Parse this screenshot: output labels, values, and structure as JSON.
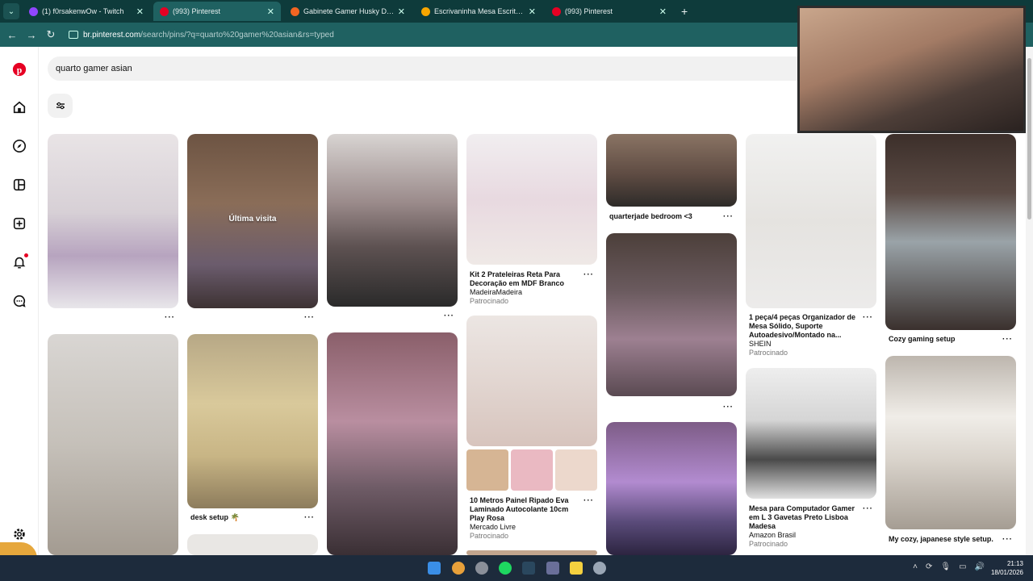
{
  "browser": {
    "tabs": [
      {
        "title": "(1) f0rsakenwOw - Twitch",
        "active": false,
        "color": "#9146ff"
      },
      {
        "title": "(993) Pinterest",
        "active": true,
        "color": "#e60023"
      },
      {
        "title": "Gabinete Gamer Husky Dome I",
        "active": false,
        "color": "#f26522"
      },
      {
        "title": "Escrivaninha Mesa Escritório An",
        "active": false,
        "color": "#f7a600"
      },
      {
        "title": "(993) Pinterest",
        "active": false,
        "color": "#e60023"
      }
    ],
    "url_host": "br.pinterest.com",
    "url_path": "/search/pins/?q=quarto%20gamer%20asian&rs=typed"
  },
  "search": {
    "query": "quarto gamer asian"
  },
  "pins": {
    "p1": {
      "dots": "···"
    },
    "p2": {
      "overlay": "Última visita",
      "dots": "···"
    },
    "p3": {
      "dots": "···"
    },
    "p4": {
      "title": "Kit 2 Prateleiras Reta Para Decoração em MDF Branco",
      "seller": "MadeiraMadeira",
      "sponsored": "Patrocinado",
      "dots": "···"
    },
    "p5": {
      "title": "quarterjade bedroom <3",
      "dots": "···"
    },
    "p6": {
      "title": "1 peça/4 peças Organizador de Mesa Sólido, Suporte Autoadesivo/Montado na...",
      "seller": "SHEIN",
      "sponsored": "Patrocinado",
      "dots": "···"
    },
    "p7": {
      "title": "Cozy gaming setup",
      "dots": "···"
    },
    "p8": {
      "title": "desk setup 🌴",
      "dots": "···"
    },
    "p9": {
      "title": "10 Metros Painel Ripado Eva Laminado Autocolante 10cm Play Rosa",
      "seller": "Mercado Livre",
      "sponsored": "Patrocinado",
      "dots": "···"
    },
    "p10": {
      "dots": "···"
    },
    "p11": {
      "title": "Mesa para Computador Gamer em L 3 Gavetas Preto Lisboa Madesa",
      "seller": "Amazon Brasil",
      "sponsored": "Patrocinado",
      "dots": "···"
    },
    "p12": {
      "title": "My cozy, japanese style setup.",
      "dots": "···"
    }
  },
  "taskbar": {
    "time": "21:13",
    "date": "18/01/2026"
  },
  "colors": {
    "brand": "#e60023",
    "chrome": "#1f6161",
    "taskbar": "#1d2b3c"
  }
}
